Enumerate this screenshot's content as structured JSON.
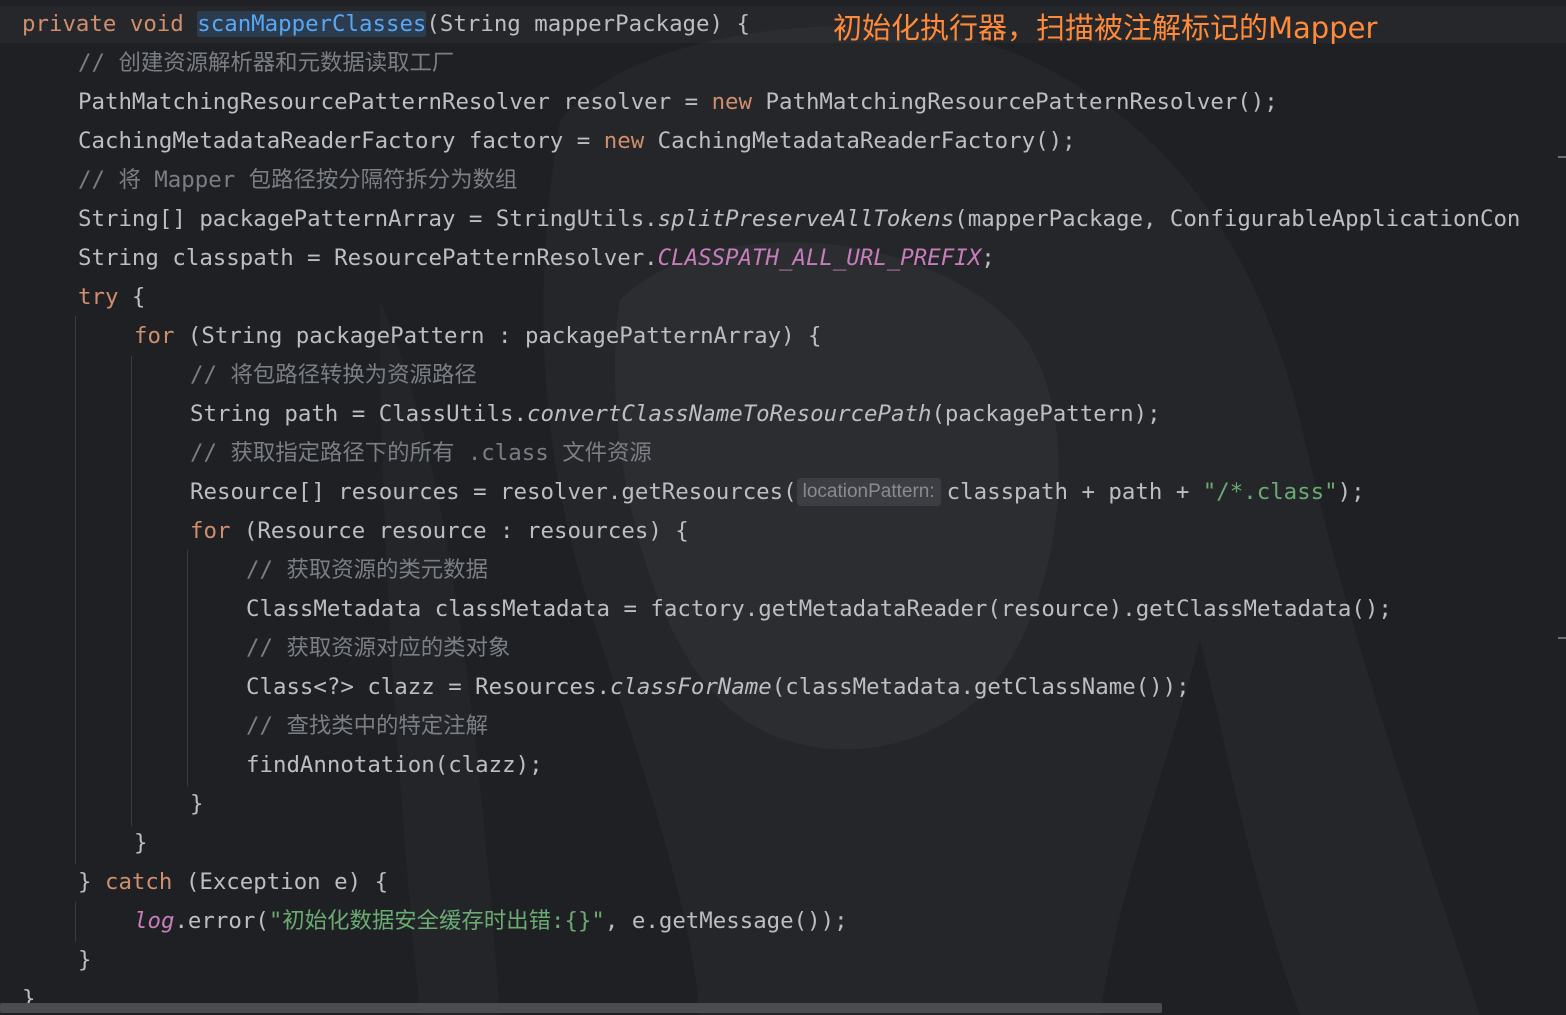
{
  "annotation": "初始化执行器，扫描被注解标记的Mapper",
  "code": {
    "l01": {
      "kw1": "private void ",
      "method": "scanMapperClasses",
      "rest": "(String mapperPackage) {"
    },
    "l02": {
      "comment": "// 创建资源解析器和元数据读取工厂"
    },
    "l03": {
      "a": "PathMatchingResourcePatternResolver resolver = ",
      "kw": "new",
      "b": " PathMatchingResourcePatternResolver();"
    },
    "l04": {
      "a": "CachingMetadataReaderFactory factory = ",
      "kw": "new",
      "b": " CachingMetadataReaderFactory();"
    },
    "l05": {
      "comment": "// 将 Mapper 包路径按分隔符拆分为数组"
    },
    "l06": {
      "a": "String[] packagePatternArray = StringUtils.",
      "it": "splitPreserveAllTokens",
      "b": "(mapperPackage, ConfigurableApplicationCon"
    },
    "l07": {
      "a": "String classpath = ResourcePatternResolver.",
      "const": "CLASSPATH_ALL_URL_PREFIX",
      "b": ";"
    },
    "l08": {
      "kw": "try",
      "b": " {"
    },
    "l09": {
      "kw": "for",
      "b": " (String packagePattern : packagePatternArray) {"
    },
    "l10": {
      "comment": "// 将包路径转换为资源路径"
    },
    "l11": {
      "a": "String path = ClassUtils.",
      "it": "convertClassNameToResourcePath",
      "b": "(packagePattern);"
    },
    "l12": {
      "comment": "// 获取指定路径下的所有 .class 文件资源"
    },
    "l13": {
      "a": "Resource[] resources = resolver.getResources(",
      "hint": "locationPattern:",
      "b": "classpath + path + ",
      "str": "\"/*.class\"",
      "c": ");"
    },
    "l14": {
      "kw": "for",
      "b": " (Resource resource : resources) {"
    },
    "l15": {
      "comment": "// 获取资源的类元数据"
    },
    "l16": {
      "a": "ClassMetadata classMetadata = factory.getMetadataReader(resource).getClassMetadata();"
    },
    "l17": {
      "comment": "// 获取资源对应的类对象"
    },
    "l18": {
      "a": "Class<?> clazz = Resources.",
      "it": "classForName",
      "b": "(classMetadata.getClassName());"
    },
    "l19": {
      "comment": "// 查找类中的特定注解"
    },
    "l20": {
      "a": "findAnnotation(clazz);"
    },
    "l21": {
      "a": "}"
    },
    "l22": {
      "a": "}"
    },
    "l23": {
      "a": "} ",
      "kw": "catch",
      "b": " (Exception e) {"
    },
    "l24": {
      "const": "log",
      "a": ".error(",
      "str": "\"初始化数据安全缓存时出错:{}\"",
      "b": ", e.getMessage());"
    },
    "l25": {
      "a": "}"
    },
    "l26": {
      "a": "}"
    }
  }
}
